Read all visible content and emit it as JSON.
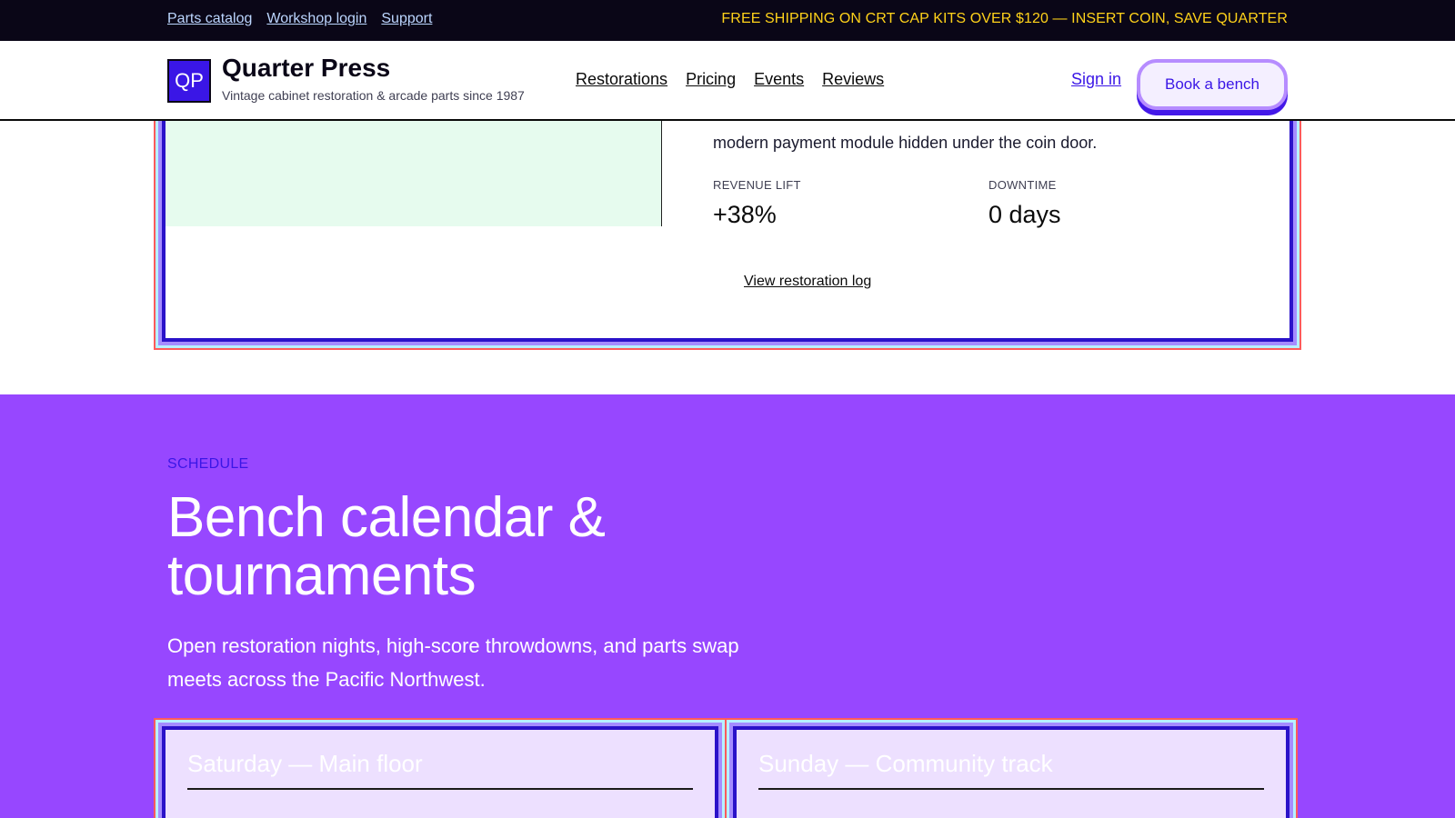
{
  "topbar": {
    "links": [
      "Parts catalog",
      "Workshop login",
      "Support"
    ],
    "promo": "FREE SHIPPING ON CRT CAP KITS OVER $120 — INSERT COIN, SAVE QUARTER"
  },
  "header": {
    "logo_text": "QP",
    "brand": "Quarter Press",
    "tagline": "Vintage cabinet restoration & arcade parts since 1987",
    "nav": [
      "Restorations",
      "Pricing",
      "Events",
      "Reviews"
    ],
    "signin": "Sign in",
    "cta": "Book a bench"
  },
  "case_study": {
    "description": "modern payment module hidden under the coin door.",
    "metrics": [
      {
        "label": "REVENUE LIFT",
        "value": "+38%"
      },
      {
        "label": "DOWNTIME",
        "value": "0 days"
      }
    ],
    "link": "View restoration log"
  },
  "schedule": {
    "eyebrow": "SCHEDULE",
    "title": "Bench calendar & tournaments",
    "subtitle": "Open restoration nights, high-score throwdowns, and parts swap meets across the Pacific Northwest.",
    "days": [
      {
        "title": "Saturday — Main floor"
      },
      {
        "title": "Sunday — Community track"
      }
    ]
  },
  "colors": {
    "accent": "#3a16e6",
    "section_bg": "#9747ff",
    "promo": "#ffd21a"
  }
}
